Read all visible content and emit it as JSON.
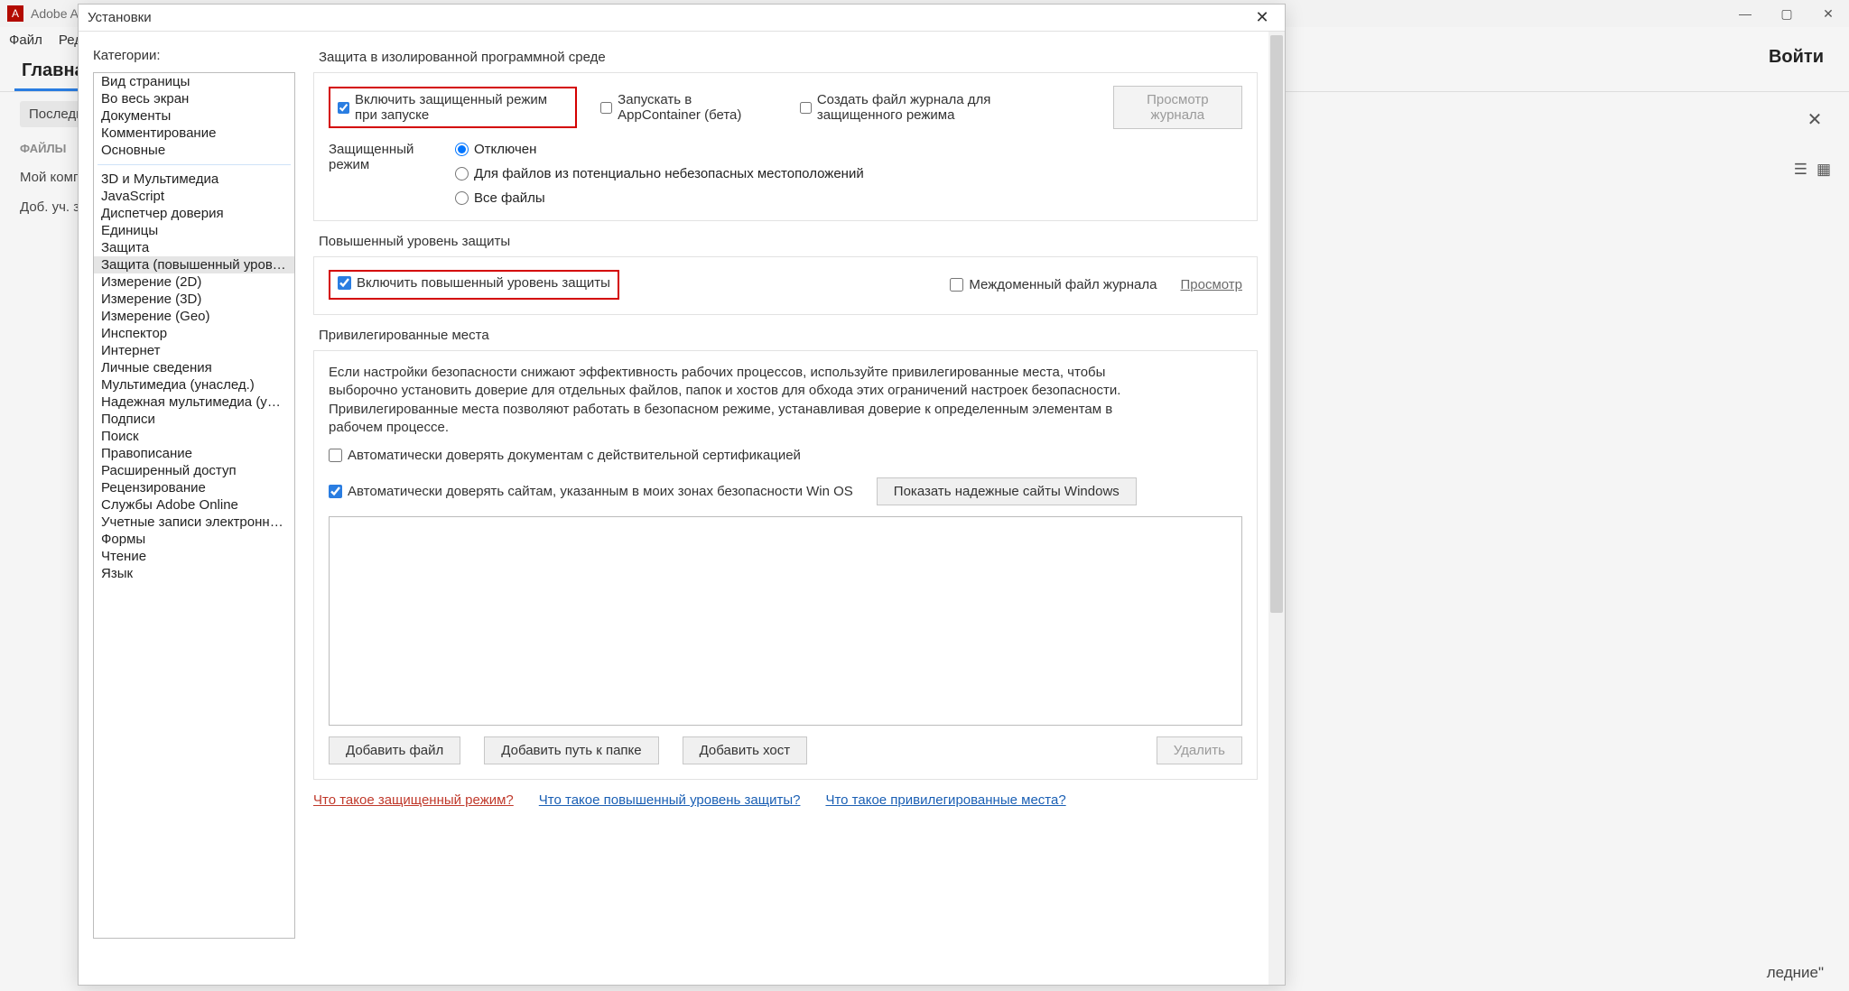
{
  "app": {
    "title": "Adobe Acro",
    "menu": [
      "Файл",
      "Редакти"
    ],
    "tab_main": "Главная",
    "login": "Войти",
    "left": {
      "recent": "Последни",
      "files_hdr": "ФАЙЛЫ",
      "mycomp": "Мой комп",
      "addacct": "Доб. уч. з"
    },
    "lastword": "ледние\""
  },
  "wincontrols": {
    "min": "—",
    "max": "▢",
    "close": "✕"
  },
  "dialog": {
    "title": "Установки",
    "categories_label": "Категории:",
    "categories_a": [
      "Вид страницы",
      "Во весь экран",
      "Документы",
      "Комментирование",
      "Основные"
    ],
    "categories_b": [
      "3D и Мультимедиа",
      "JavaScript",
      "Диспетчер доверия",
      "Единицы",
      "Защита",
      "Защита (повышенный уровень)",
      "Измерение (2D)",
      "Измерение (3D)",
      "Измерение (Geo)",
      "Инспектор",
      "Интернет",
      "Личные сведения",
      "Мультимедиа (унаслед.)",
      "Надежная мультимедиа (унаслед.)",
      "Подписи",
      "Поиск",
      "Правописание",
      "Расширенный доступ",
      "Рецензирование",
      "Службы Adobe Online",
      "Учетные записи электронной почты",
      "Формы",
      "Чтение",
      "Язык"
    ],
    "selected_category": "Защита (повышенный уровень)"
  },
  "section1": {
    "title": "Защита в изолированной программной среде",
    "chk_protected": "Включить защищенный режим при запуске",
    "chk_appcontainer": "Запускать в AppContainer (бета)",
    "chk_logfile": "Создать файл журнала для защищенного режима",
    "btn_viewlog": "Просмотр журнала",
    "mode_label": "Защищенный режим",
    "radio1": "Отключен",
    "radio2": "Для файлов из потенциально небезопасных местоположений",
    "radio3": "Все файлы"
  },
  "section2": {
    "title": "Повышенный уровень защиты",
    "chk_enhanced": "Включить повышенный уровень защиты",
    "chk_crossdomain": "Междоменный файл журнала",
    "link_view": "Просмотр"
  },
  "section3": {
    "title": "Привилегированные места",
    "para": "Если настройки безопасности снижают эффективность рабочих процессов, используйте привилегированные места, чтобы выборочно установить доверие для отдельных файлов, папок и хостов для обхода этих ограничений настроек безопасности. Привилегированные места позволяют работать в безопасном режиме, устанавливая доверие к определенным элементам в рабочем процессе.",
    "chk_certdocs": "Автоматически доверять документам с действительной сертификацией",
    "chk_oszones": "Автоматически доверять сайтам, указанным в моих зонах безопасности Win OS",
    "btn_showwin": "Показать надежные сайты Windows",
    "btn_addfile": "Добавить файл",
    "btn_addfolder": "Добавить путь к папке",
    "btn_addhost": "Добавить хост",
    "btn_delete": "Удалить"
  },
  "help": {
    "l1": "Что такое защищенный режим?",
    "l2": "Что такое повышенный уровень защиты?",
    "l3": "Что такое привилегированные места?"
  }
}
